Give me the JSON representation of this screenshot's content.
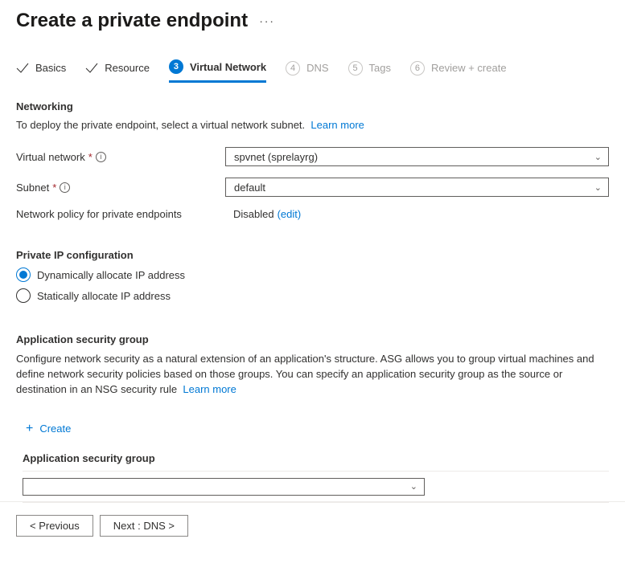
{
  "header": {
    "title": "Create a private endpoint"
  },
  "tabs": [
    {
      "label": "Basics"
    },
    {
      "label": "Resource"
    },
    {
      "label": "Virtual Network",
      "num": "3"
    },
    {
      "label": "DNS",
      "num": "4"
    },
    {
      "label": "Tags",
      "num": "5"
    },
    {
      "label": "Review + create",
      "num": "6"
    }
  ],
  "networking": {
    "heading": "Networking",
    "help": "To deploy the private endpoint, select a virtual network subnet.",
    "learn": "Learn more",
    "vnet_label": "Virtual network",
    "vnet_value": "spvnet (sprelayrg)",
    "subnet_label": "Subnet",
    "subnet_value": "default",
    "policy_label": "Network policy for private endpoints",
    "policy_value": "Disabled",
    "policy_edit": "(edit)"
  },
  "ipconfig": {
    "heading": "Private IP configuration",
    "dynamic": "Dynamically allocate IP address",
    "static": "Statically allocate IP address"
  },
  "asg": {
    "heading": "Application security group",
    "desc": "Configure network security as a natural extension of an application's structure. ASG allows you to group virtual machines and define network security policies based on those groups. You can specify an application security group as the source or destination in an NSG security rule",
    "learn": "Learn more",
    "create": "Create",
    "label": "Application security group"
  },
  "footer": {
    "prev": "<  Previous",
    "next": "Next : DNS  >"
  }
}
